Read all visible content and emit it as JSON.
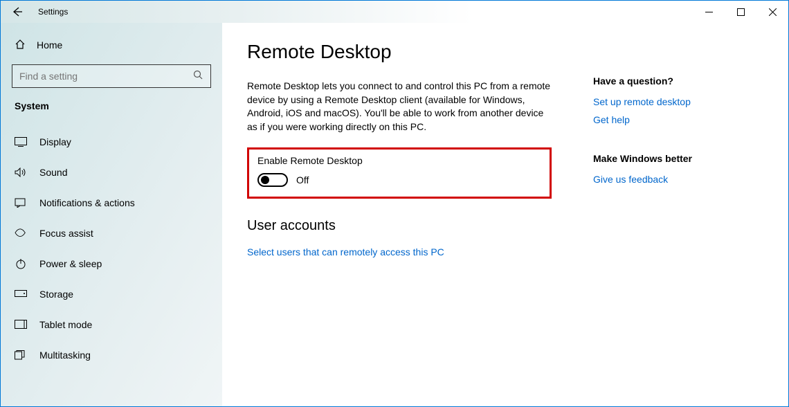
{
  "titlebar": {
    "app_name": "Settings"
  },
  "sidebar": {
    "home_label": "Home",
    "search_placeholder": "Find a setting",
    "category": "System",
    "items": [
      {
        "label": "Display"
      },
      {
        "label": "Sound"
      },
      {
        "label": "Notifications & actions"
      },
      {
        "label": "Focus assist"
      },
      {
        "label": "Power & sleep"
      },
      {
        "label": "Storage"
      },
      {
        "label": "Tablet mode"
      },
      {
        "label": "Multitasking"
      }
    ]
  },
  "main": {
    "title": "Remote Desktop",
    "description": "Remote Desktop lets you connect to and control this PC from a remote device by using a Remote Desktop client (available for Windows, Android, iOS and macOS). You'll be able to work from another device as if you were working directly on this PC.",
    "enable_label": "Enable Remote Desktop",
    "toggle_state": "Off",
    "section2_title": "User accounts",
    "select_users_link": "Select users that can remotely access this PC"
  },
  "aside": {
    "q_title": "Have a question?",
    "link_setup": "Set up remote desktop",
    "link_help": "Get help",
    "better_title": "Make Windows better",
    "link_feedback": "Give us feedback"
  }
}
